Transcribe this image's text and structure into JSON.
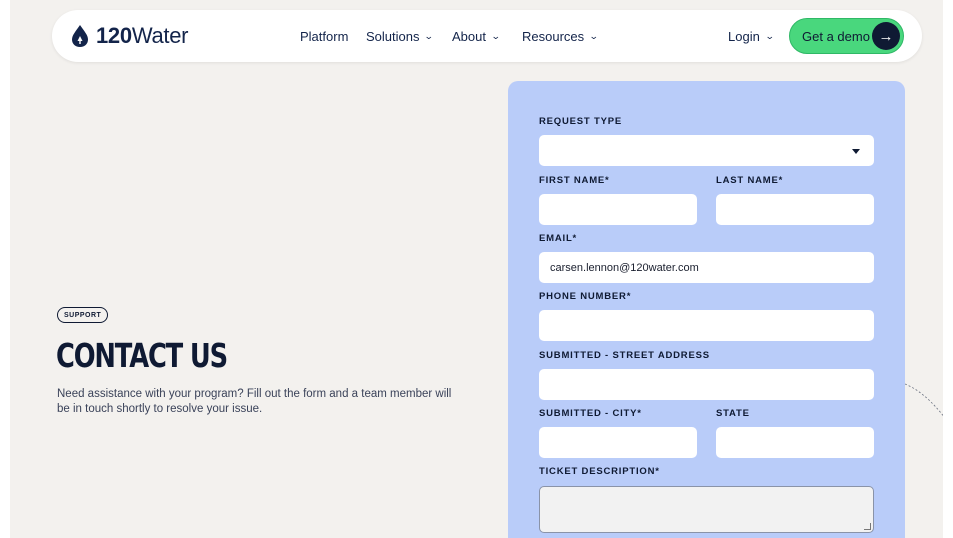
{
  "nav": {
    "logo_number": "120",
    "logo_word": "Water",
    "links": [
      {
        "label": "Platform",
        "has_dropdown": false
      },
      {
        "label": "Solutions",
        "has_dropdown": true
      },
      {
        "label": "About",
        "has_dropdown": true
      },
      {
        "label": "Resources",
        "has_dropdown": true
      }
    ],
    "login_label": "Login",
    "demo_label": "Get a demo",
    "demo_color": "#49d77d"
  },
  "hero": {
    "badge": "SUPPORT",
    "title": "CONTACT US",
    "description": "Need assistance with your program? Fill out the form and a team member will be in touch shortly to resolve your issue."
  },
  "form": {
    "panel_color": "#b9ccf9",
    "request_type": {
      "label": "REQUEST TYPE",
      "value": ""
    },
    "first_name": {
      "label": "FIRST NAME*",
      "value": ""
    },
    "last_name": {
      "label": "LAST NAME*",
      "value": ""
    },
    "email": {
      "label": "EMAIL*",
      "value": "carsen.lennon@120water.com"
    },
    "phone": {
      "label": "PHONE NUMBER*",
      "value": ""
    },
    "street": {
      "label": "SUBMITTED - STREET ADDRESS",
      "value": ""
    },
    "city": {
      "label": "SUBMITTED - CITY*",
      "value": ""
    },
    "state": {
      "label": "STATE",
      "value": ""
    },
    "ticket": {
      "label": "TICKET DESCRIPTION*",
      "value": ""
    }
  }
}
